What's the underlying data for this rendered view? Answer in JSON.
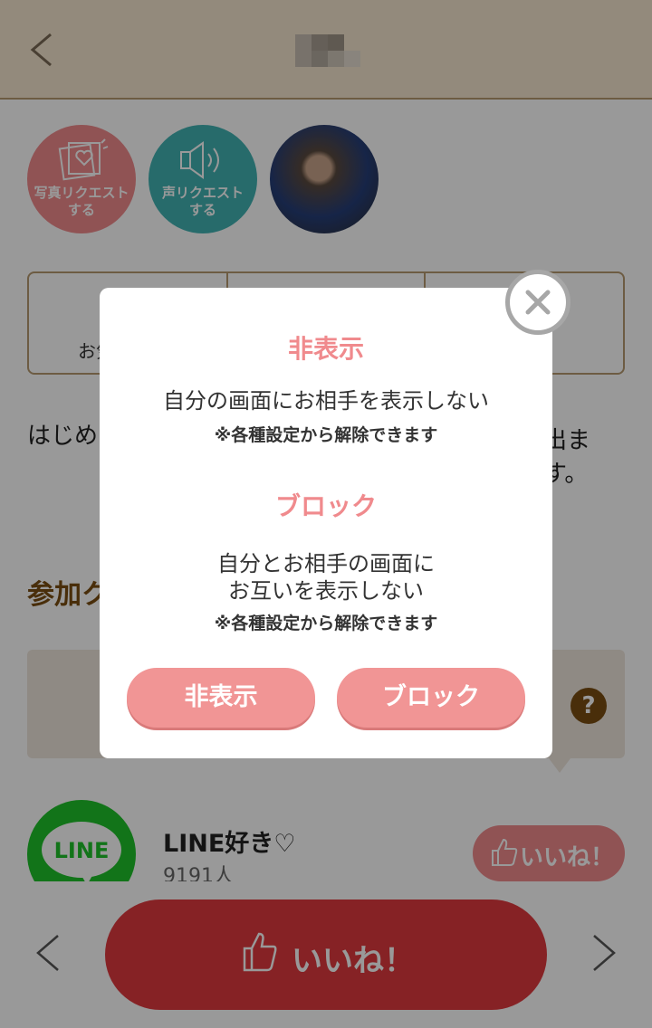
{
  "header": {
    "back_icon": "chevron-left-icon"
  },
  "profile_actions": {
    "photo_request": "写真リクエストする",
    "voice_request": "声リクエストする"
  },
  "stats": {
    "cell1_label": "お気"
  },
  "intro": {
    "text": "はじめ",
    "tail": "出ます。"
  },
  "community": {
    "section_title": "参加ク",
    "logo_text": "LINE",
    "name": "LINE好き♡",
    "count": "9191人",
    "like_label": "いいね！"
  },
  "footer": {
    "like_label": "いいね！"
  },
  "modal": {
    "hide_heading": "非表示",
    "hide_desc": "自分の画面にお相手を表示しない",
    "hide_note": "※各種設定から解除できます",
    "block_heading": "ブロック",
    "block_desc_line1": "自分とお相手の画面に",
    "block_desc_line2": "お互いを表示しない",
    "block_note": "※各種設定から解除できます",
    "hide_button": "非表示",
    "block_button": "ブロック"
  },
  "colors": {
    "accent_pink": "#f08a8d",
    "header_beige": "#f6e7cf",
    "brown": "#7a4e12",
    "teal": "#42b3b3",
    "line_green": "#1fc12b",
    "like_red": "#e03a3e"
  }
}
